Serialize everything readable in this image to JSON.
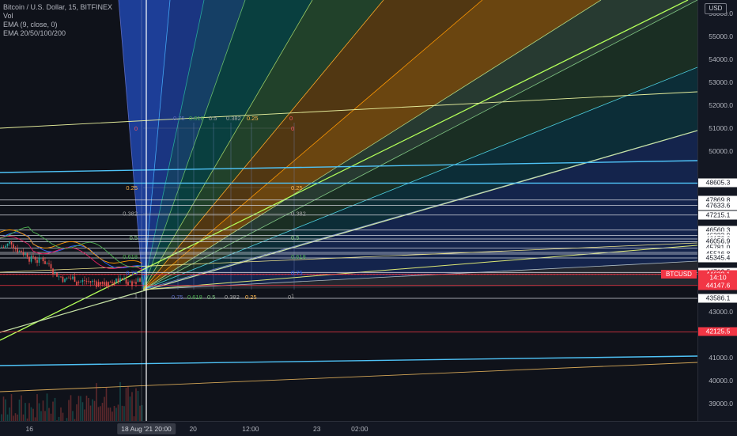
{
  "legend": {
    "title": "Bitcoin / U.S. Dollar, 15, BITFINEX",
    "vol": "Vol",
    "ema1": "EMA (9, close, 0)",
    "ema2": "EMA 20/50/100/200"
  },
  "currency_badge": "USD",
  "ticker_tag": "BTCUSD",
  "price_axis": {
    "ticks": [
      "56000.0",
      "55000.0",
      "54000.0",
      "53000.0",
      "52000.0",
      "51000.0",
      "50000.0",
      "43000.0",
      "41000.0",
      "40000.0",
      "39000.0"
    ],
    "tick_values": [
      56000,
      55000,
      54000,
      53000,
      52000,
      51000,
      50000,
      43000,
      41000,
      40000,
      39000
    ],
    "labels": [
      {
        "text": "48605.3",
        "value": 48605.3,
        "bg": "#ffffff",
        "fg": "#131722"
      },
      {
        "text": "47869.8",
        "value": 47869.8,
        "bg": "#ffffff",
        "fg": "#131722"
      },
      {
        "text": "47633.6",
        "value": 47633.6,
        "bg": "#ffffff",
        "fg": "#131722"
      },
      {
        "text": "47215.1",
        "value": 47215.1,
        "bg": "#ffffff",
        "fg": "#131722"
      },
      {
        "text": "46560.3",
        "value": 46560.3,
        "bg": "#ffffff",
        "fg": "#131722"
      },
      {
        "text": "46323.9",
        "value": 46323.9,
        "bg": "#ffffff",
        "fg": "#131722"
      },
      {
        "text": "46172.6",
        "value": 46172.6,
        "bg": "#ffffff",
        "fg": "#131722"
      },
      {
        "text": "46056.9",
        "value": 46056.9,
        "bg": "#ffffff",
        "fg": "#131722"
      },
      {
        "text": "45781.0",
        "value": 45781.0,
        "bg": "#ffffff",
        "fg": "#131722"
      },
      {
        "text": "45585.2",
        "value": 45585.2,
        "bg": "#ffffff",
        "fg": "#131722"
      },
      {
        "text": "45516.8",
        "value": 45516.8,
        "bg": "#ffffff",
        "fg": "#131722"
      },
      {
        "text": "45345.4",
        "value": 45345.4,
        "bg": "#ffffff",
        "fg": "#131722"
      },
      {
        "text": "44713.5",
        "value": 44713.5,
        "bg": "#ffffff",
        "fg": "#131722"
      },
      {
        "text": "44632.1",
        "value": 44632.1,
        "bg": "#f23645",
        "fg": "#ffffff"
      },
      {
        "text": "14:10",
        "value": 44480,
        "bg": "#f23645",
        "fg": "#ffffff"
      },
      {
        "text": "44147.6",
        "value": 44147.6,
        "bg": "#f23645",
        "fg": "#ffffff"
      },
      {
        "text": "43586.1",
        "value": 43586.1,
        "bg": "#ffffff",
        "fg": "#131722"
      },
      {
        "text": "42125.5",
        "value": 42125.5,
        "bg": "#f23645",
        "fg": "#ffffff"
      }
    ]
  },
  "time_axis": {
    "ticks": [
      {
        "text": "16",
        "pos": 0.04
      },
      {
        "text": "20",
        "pos": 0.262
      },
      {
        "text": "12:00",
        "pos": 0.34
      },
      {
        "text": "23",
        "pos": 0.43
      },
      {
        "text": "02:00",
        "pos": 0.488
      }
    ],
    "crosshair_label": "18 Aug '21  20:00"
  },
  "fib_labels": {
    "left": [
      "0",
      "0.25",
      "0.382",
      "0.5",
      "0.618",
      "0.75",
      "1"
    ],
    "left_values": [
      51000,
      48410,
      47300,
      46240,
      45420,
      44710,
      43700
    ],
    "right": [
      "0",
      "0.25",
      "0.382",
      "0.5",
      "0.618",
      "0.75",
      "1"
    ],
    "top": [
      "0.75",
      "0.618",
      "0.5",
      "0.382",
      "0.25",
      "0"
    ],
    "bottom": [
      "0.75",
      "0.618",
      "0.5",
      "0.382",
      "0.25",
      "0"
    ],
    "colors": [
      "#f7525f",
      "#ffb74d",
      "#a5a5a5",
      "#81c784",
      "#4caf50",
      "#2962ff",
      "#9e9e9e"
    ]
  },
  "colors": {
    "background": "#131722",
    "candle_up": "#26a69a",
    "candle_down": "#ef5350",
    "price_line": "#f23645"
  }
}
